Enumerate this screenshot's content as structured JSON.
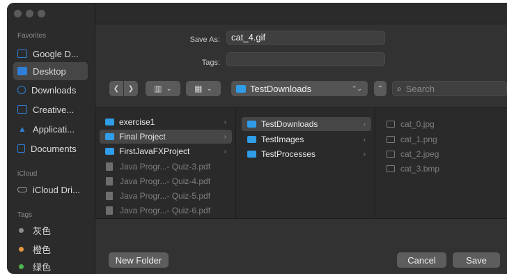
{
  "sidebar": {
    "favorites_label": "Favorites",
    "favorites": [
      {
        "label": "Google D...",
        "icon": "folder-icon"
      },
      {
        "label": "Desktop",
        "icon": "desktop-icon",
        "selected": true
      },
      {
        "label": "Downloads",
        "icon": "downloads-icon"
      },
      {
        "label": "Creative...",
        "icon": "folder-icon"
      },
      {
        "label": "Applicati...",
        "icon": "applications-icon"
      },
      {
        "label": "Documents",
        "icon": "document-icon"
      }
    ],
    "icloud_label": "iCloud",
    "icloud": [
      {
        "label": "iCloud Dri...",
        "icon": "cloud-icon"
      }
    ],
    "tags_label": "Tags",
    "tags": [
      {
        "label": "灰色",
        "color": "#8e8e8e"
      },
      {
        "label": "橙色",
        "color": "#e3963e"
      },
      {
        "label": "绿色",
        "color": "#4cb64f"
      }
    ]
  },
  "form": {
    "save_as_label": "Save As:",
    "save_as_value": "cat_4.gif",
    "tags_label": "Tags:",
    "tags_value": ""
  },
  "toolbar": {
    "back_icon": "chevron-left-icon",
    "forward_icon": "chevron-right-icon",
    "view_columns_icon": "columns-view-icon",
    "group_icon": "grid-icon",
    "location": "TestDownloads",
    "search_placeholder": "Search"
  },
  "columns": [
    [
      {
        "label": "exercise1",
        "type": "folder",
        "chevron": true
      },
      {
        "label": "Final Project",
        "type": "folder",
        "chevron": true,
        "selected": true
      },
      {
        "label": "FirstJavaFXProject",
        "type": "folder",
        "chevron": true
      },
      {
        "label": "Java Progr...- Quiz-3.pdf",
        "type": "pdf",
        "dim": true
      },
      {
        "label": "Java Progr...- Quiz-4.pdf",
        "type": "pdf",
        "dim": true
      },
      {
        "label": "Java Progr...- Quiz-5.pdf",
        "type": "pdf",
        "dim": true
      },
      {
        "label": "Java Progr...- Quiz-6.pdf",
        "type": "pdf",
        "dim": true
      }
    ],
    [
      {
        "label": "TestDownloads",
        "type": "folder",
        "chevron": true,
        "selected": true
      },
      {
        "label": "TestImages",
        "type": "folder",
        "chevron": true
      },
      {
        "label": "TestProcesses",
        "type": "folder",
        "chevron": true
      }
    ],
    [
      {
        "label": "cat_0.jpg",
        "type": "image",
        "dim": true
      },
      {
        "label": "cat_1.png",
        "type": "image",
        "dim": true
      },
      {
        "label": "cat_2.jpeg",
        "type": "image",
        "dim": true
      },
      {
        "label": "cat_3.bmp",
        "type": "image",
        "dim": true
      }
    ]
  ],
  "buttons": {
    "new_folder": "New Folder",
    "cancel": "Cancel",
    "save": "Save"
  }
}
